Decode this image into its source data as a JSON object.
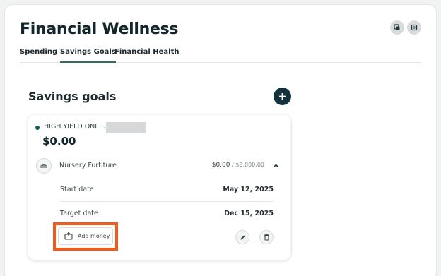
{
  "page": {
    "title": "Financial Wellness"
  },
  "header_actions": [
    {
      "icon": "copy-icon"
    },
    {
      "icon": "duplicate-icon"
    }
  ],
  "tabs": [
    {
      "label": "Spending",
      "active": false
    },
    {
      "label": "Savings Goals",
      "active": true
    },
    {
      "label": "Financial Health",
      "active": false
    }
  ],
  "savings": {
    "title": "Savings goals",
    "add_icon": "plus-icon",
    "card": {
      "account_name": "HIGH YIELD ONL ...",
      "balance": "$0.00",
      "goal": {
        "icon": "crib-icon",
        "name": "Nursery Furtiture",
        "saved": "$0.00",
        "separator": " / ",
        "target": "$3,000.00",
        "expand_icon": "chevron-up-icon"
      },
      "start_label": "Start date",
      "start_value": "May 12, 2025",
      "target_label": "Target date",
      "target_value": "Dec 15, 2025",
      "add_money_label": "Add money",
      "add_money_icon": "add-money-icon",
      "edit_icon": "pencil-icon",
      "delete_icon": "trash-icon"
    }
  },
  "colors": {
    "accent": "#2f6b5f",
    "dark_button": "#133239",
    "highlight": "#f05a1a",
    "account_dot": "#0f5b52"
  }
}
